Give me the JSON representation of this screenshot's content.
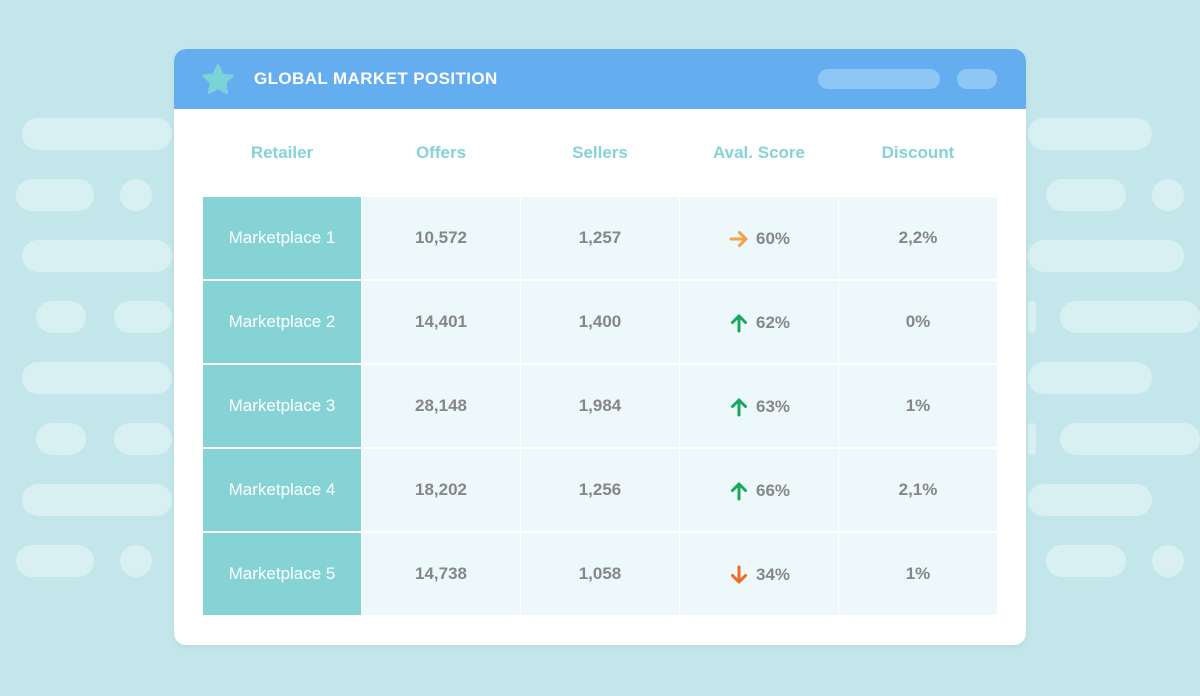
{
  "window": {
    "title": "GLOBAL MARKET POSITION"
  },
  "table": {
    "headers": [
      "Retailer",
      "Offers",
      "Sellers",
      "Aval. Score",
      "Discount"
    ],
    "rows": [
      {
        "retailer": "Marketplace 1",
        "offers": "10,572",
        "sellers": "1,257",
        "score": "60%",
        "trend": "right-arrow-icon",
        "trend_color": "#f7a04b",
        "discount": "2,2%"
      },
      {
        "retailer": "Marketplace 2",
        "offers": "14,401",
        "sellers": "1,400",
        "score": "62%",
        "trend": "up-arrow-icon",
        "trend_color": "#1aa65b",
        "discount": "0%"
      },
      {
        "retailer": "Marketplace 3",
        "offers": "28,148",
        "sellers": "1,984",
        "score": "63%",
        "trend": "up-arrow-icon",
        "trend_color": "#1aa65b",
        "discount": "1%"
      },
      {
        "retailer": "Marketplace 4",
        "offers": "18,202",
        "sellers": "1,256",
        "score": "66%",
        "trend": "up-arrow-icon",
        "trend_color": "#1aa65b",
        "discount": "2,1%"
      },
      {
        "retailer": "Marketplace 5",
        "offers": "14,738",
        "sellers": "1,058",
        "score": "34%",
        "trend": "down-arrow-icon",
        "trend_color": "#f06a22",
        "discount": "1%"
      }
    ]
  },
  "colors": {
    "background": "#c3e6ea",
    "titlebar": "#64aef0",
    "star": "#7ad3d6",
    "retailer_cell": "#86d3d6",
    "data_cell": "#ecf8f9",
    "header_text": "#85d3d6"
  },
  "icons": {
    "title": "star-icon"
  }
}
